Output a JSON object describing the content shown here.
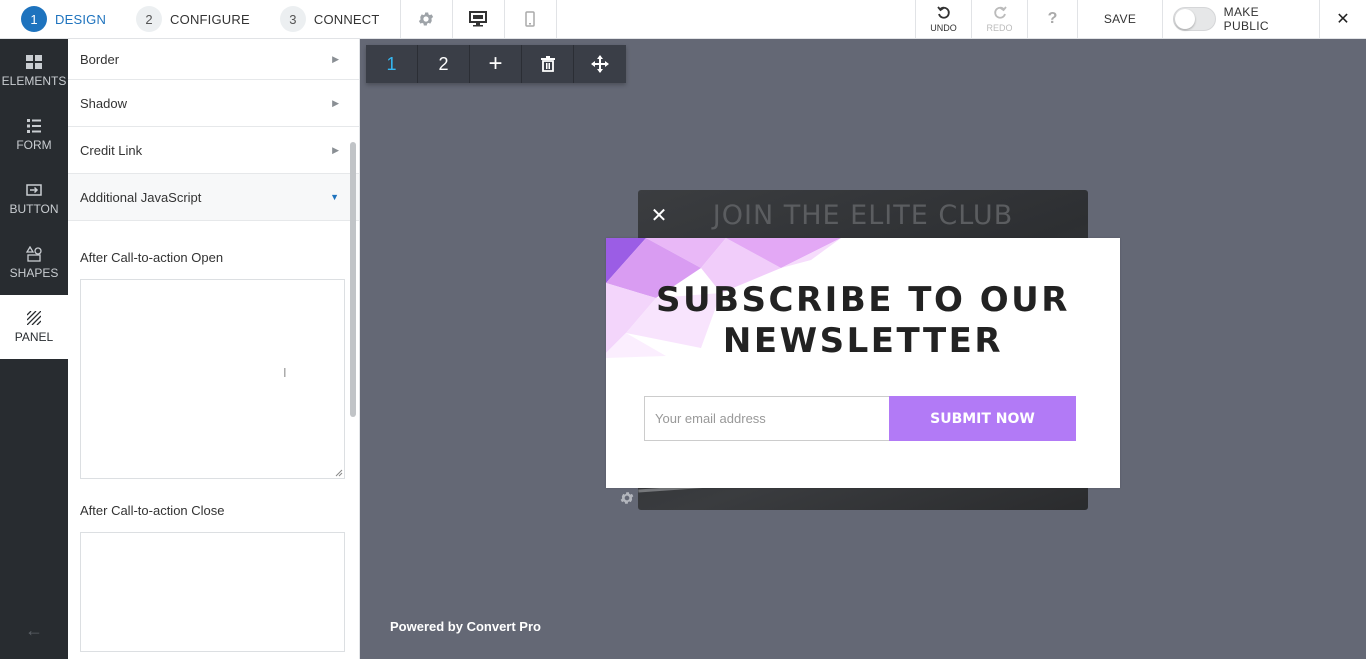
{
  "topbar": {
    "steps": [
      {
        "num": "1",
        "label": "DESIGN"
      },
      {
        "num": "2",
        "label": "CONFIGURE"
      },
      {
        "num": "3",
        "label": "CONNECT"
      }
    ],
    "undo_label": "UNDO",
    "redo_label": "REDO",
    "help_label": "?",
    "save_label": "SAVE",
    "make_public_label": "MAKE PUBLIC",
    "close_glyph": "✕"
  },
  "leftnav": {
    "items": [
      {
        "label": "ELEMENTS",
        "icon": "grid-icon"
      },
      {
        "label": "FORM",
        "icon": "form-icon"
      },
      {
        "label": "BUTTON",
        "icon": "button-icon"
      },
      {
        "label": "SHAPES",
        "icon": "shapes-icon"
      },
      {
        "label": "PANEL",
        "icon": "panel-icon"
      }
    ],
    "active": "PANEL",
    "back_glyph": "←"
  },
  "panel": {
    "sections": [
      {
        "label": "Border",
        "open": false
      },
      {
        "label": "Shadow",
        "open": false
      },
      {
        "label": "Credit Link",
        "open": false
      },
      {
        "label": "Additional JavaScript",
        "open": true
      }
    ],
    "fields": [
      {
        "label": "After Call-to-action Open",
        "value": ""
      },
      {
        "label": "After Call-to-action Close",
        "value": ""
      }
    ]
  },
  "canvas": {
    "step_toolbar": {
      "step1": "1",
      "step2": "2",
      "add": "+"
    },
    "bg_card_title": "JOIN THE ELITE CLUB",
    "popup": {
      "title_line1": "SUBSCRIBE TO OUR",
      "title_line2": "NEWSLETTER",
      "email_placeholder": "Your email address",
      "submit_label": "SUBMIT NOW"
    },
    "powered_by": "Powered by Convert Pro",
    "close_glyph": "✕"
  },
  "colors": {
    "accent": "#1e73be",
    "canvas_bg": "#646875",
    "nav_bg": "#282c30",
    "submit_bg": "#b27af6",
    "step_active": "#35b6f0"
  }
}
